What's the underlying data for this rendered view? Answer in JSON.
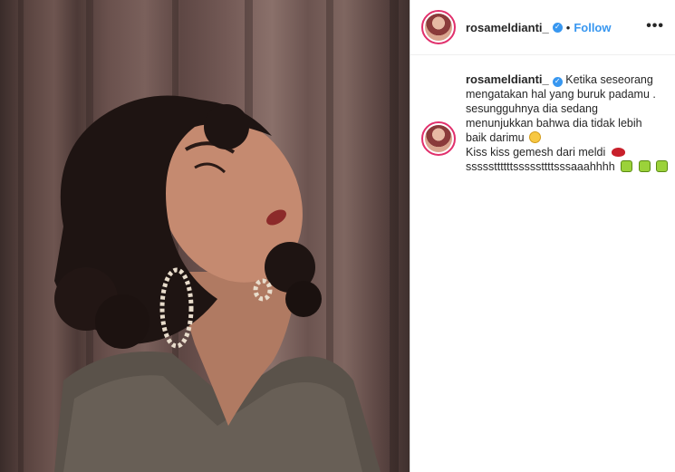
{
  "post": {
    "username": "rosameldianti_",
    "separator": "•",
    "follow_label": "Follow",
    "more_label": "•••",
    "verified_symbol": "✓"
  },
  "caption": {
    "username": "rosameldianti_",
    "lines": [
      "Ketika seseorang",
      "mengatakan hal yang buruk padamu .",
      "sesungguhnya dia sedang",
      "menunjukkan bahwa dia tidak lebih",
      "baik darimu",
      "Kiss kiss gemesh dari meldi",
      "sssssttttttsssssttttsssaaahhhh"
    ],
    "emojis": {
      "smile": "slightly-smiling-face-icon",
      "kiss": "kiss-mark-icon",
      "boxes": [
        "green-emoji-icon",
        "green-emoji-icon",
        "green-emoji-icon"
      ]
    }
  },
  "colors": {
    "link_blue": "#3897f0",
    "text": "#262626",
    "border": "#efefef"
  }
}
